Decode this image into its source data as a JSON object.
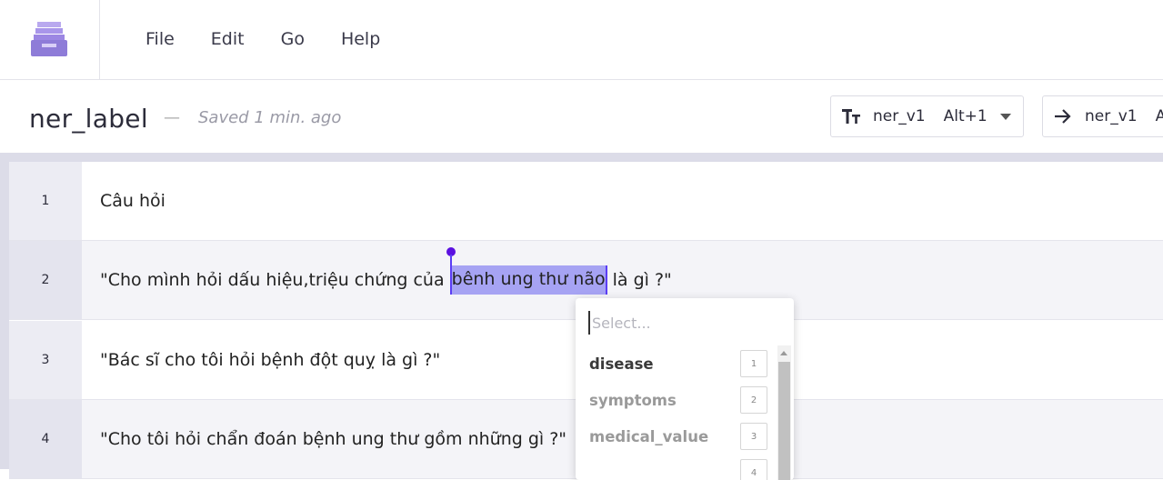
{
  "menu": {
    "items": [
      {
        "label": "File"
      },
      {
        "label": "Edit"
      },
      {
        "label": "Go"
      },
      {
        "label": "Help"
      }
    ]
  },
  "header": {
    "title": "ner_label",
    "separator": "—",
    "saved_status": "Saved 1 min. ago",
    "format_selector": {
      "icon": "text-format-icon",
      "name": "ner_v1",
      "shortcut": "Alt+1"
    },
    "relation_selector": {
      "icon": "arrow-right-icon",
      "name": "ner_v1",
      "shortcut": "A"
    }
  },
  "rows": [
    {
      "num": "1",
      "text": "Câu hỏi"
    },
    {
      "num": "2",
      "text_before": "\"Cho mình hỏi dấu hiệu,triệu chứng của ",
      "highlight": "bênh ung thư não",
      "text_after": " là gì ?\""
    },
    {
      "num": "3",
      "text": "\"Bác sĩ cho tôi hỏi bệnh đột quỵ là gì ?\""
    },
    {
      "num": "4",
      "text": "\"Cho tôi hỏi chẩn đoán bệnh ung thư gồm những gì ?\""
    }
  ],
  "dropdown": {
    "placeholder": "Select...",
    "options": [
      {
        "label": "disease",
        "key": "1"
      },
      {
        "label": "symptoms",
        "key": "2"
      },
      {
        "label": "medical_value",
        "key": "3"
      },
      {
        "label": "",
        "key": "4"
      }
    ]
  },
  "colors": {
    "accent": "#5b3df5",
    "highlight": "#a6a3f3",
    "logo": "#8e7cd8"
  }
}
